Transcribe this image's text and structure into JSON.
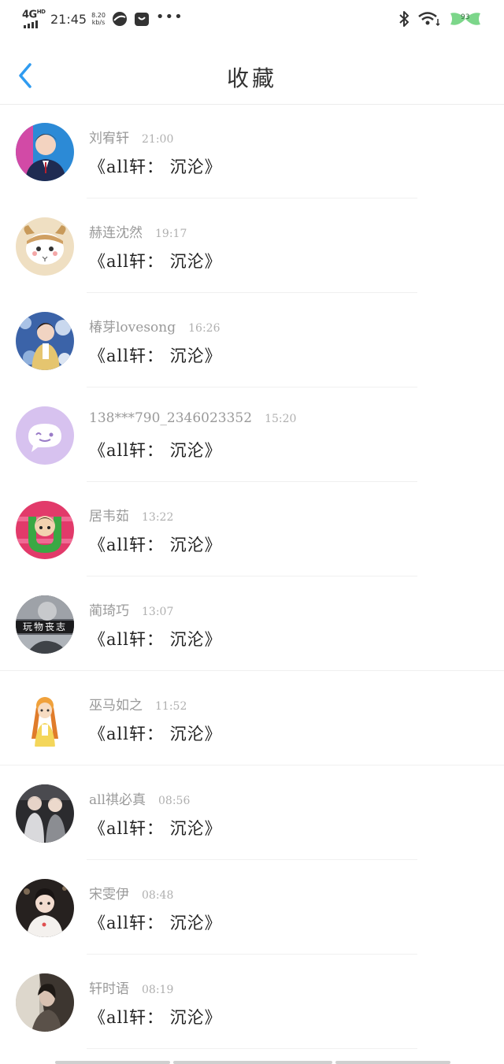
{
  "status": {
    "network": "4G",
    "network_sup": "HD",
    "time": "21:45",
    "speed_value": "8.20",
    "speed_unit": "kb/s",
    "more": "•••",
    "battery": "93"
  },
  "header": {
    "title": "收藏",
    "back_icon": "chevron-left-icon"
  },
  "colors": {
    "accent": "#2f9bf0",
    "name": "#9a9a9a",
    "content": "#222222"
  },
  "items": [
    {
      "name": "刘宥轩",
      "time": "21:00",
      "content": "《all轩：  沉沦》"
    },
    {
      "name": "赫连沈然",
      "time": "19:17",
      "content": "《all轩：  沉沦》"
    },
    {
      "name": "椿芽lovesong",
      "time": "16:26",
      "content": "《all轩：  沉沦》"
    },
    {
      "name": "138***790_2346023352",
      "time": "15:20",
      "content": "《all轩：  沉沦》"
    },
    {
      "name": "居韦茹",
      "time": "13:22",
      "content": "《all轩：  沉沦》"
    },
    {
      "name": "蔺琦巧",
      "time": "13:07",
      "content": "《all轩：  沉沦》",
      "avatar_text": "玩物丧志"
    },
    {
      "name": "巫马如之",
      "time": "11:52",
      "content": "《all轩：  沉沦》"
    },
    {
      "name": "all祺必真",
      "time": "08:56",
      "content": "《all轩：  沉沦》"
    },
    {
      "name": "宋雯伊",
      "time": "08:48",
      "content": "《all轩：  沉沦》"
    },
    {
      "name": "轩时语",
      "time": "08:19",
      "content": "《all轩：  沉沦》"
    }
  ]
}
